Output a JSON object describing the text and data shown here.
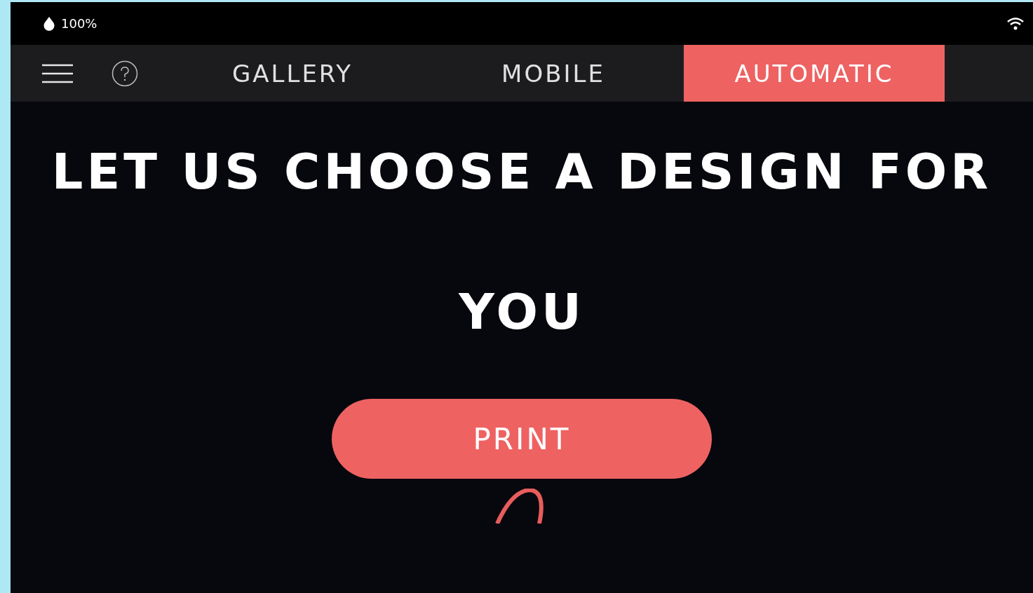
{
  "status_bar": {
    "battery": "100%"
  },
  "tabs": [
    {
      "label": "GALLERY",
      "selected": false
    },
    {
      "label": "MOBILE",
      "selected": false
    },
    {
      "label": "AUTOMATIC",
      "selected": true
    }
  ],
  "hero": {
    "heading": "LET US CHOOSE A DESIGN FOR YOU",
    "button": "PRINT"
  }
}
